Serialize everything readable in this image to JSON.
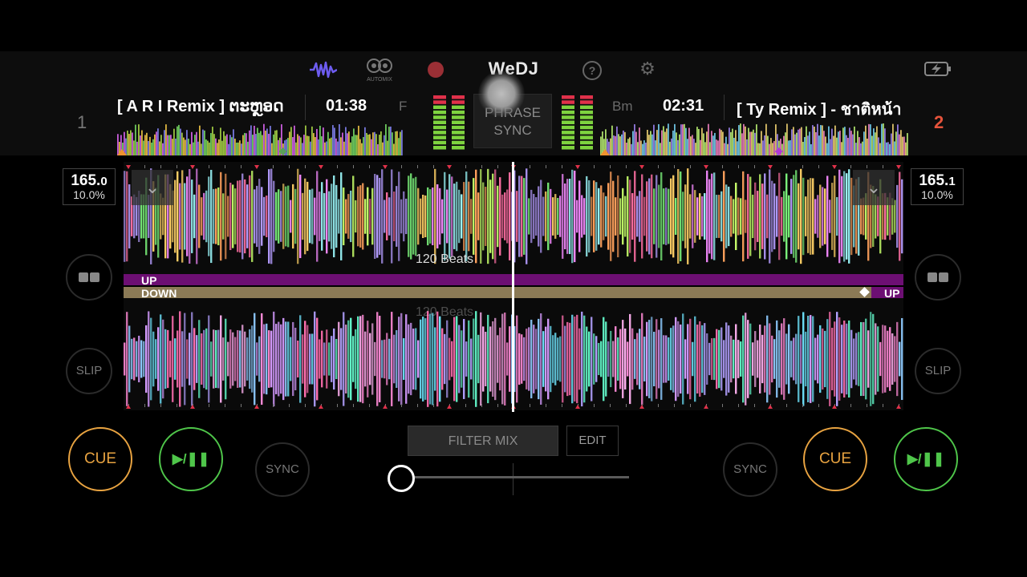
{
  "app": {
    "logo": "WeDJ"
  },
  "header": {
    "automix_label": "AUTOMIX",
    "help_glyph": "?",
    "icons": [
      "waveform-icon",
      "automix-icon",
      "record-icon",
      "help-icon",
      "gear-icon",
      "battery-charging-icon"
    ]
  },
  "deck1": {
    "number": "1",
    "title": "[ A R I Remix ] ຕະຫຼອດ",
    "time": "01:38",
    "key": "F",
    "bpm": "165.0",
    "bpm_big": "165.",
    "bpm_small": "0",
    "pitch": "10.0%",
    "beats_label": "120 Beats",
    "cue_label": "CUE",
    "play_label": "▶/❚❚",
    "sync_label": "SYNC",
    "slip_label": "SLIP",
    "color": "#777777"
  },
  "deck2": {
    "number": "2",
    "title": "[ Ty Remix ] - ชาติหน้า",
    "time": "02:31",
    "key": "Bm",
    "bpm": "165.1",
    "bpm_big": "165.",
    "bpm_small": "1",
    "pitch": "10.0%",
    "beats_label": "120 Beats",
    "cue_label": "CUE",
    "play_label": "▶/❚❚",
    "sync_label": "SYNC",
    "slip_label": "SLIP",
    "color": "#e5533b"
  },
  "center": {
    "phrase_sync_line1": "PHRASE",
    "phrase_sync_line2": "SYNC",
    "filter_mix_label": "FILTER MIX",
    "edit_label": "EDIT",
    "crossfader_position": 0.0
  },
  "phrase_bars": {
    "up_label": "UP",
    "down_label": "DOWN",
    "up_right_label": "UP"
  },
  "colors": {
    "cue": "#e8a341",
    "play": "#4fc64a",
    "phrase_up": "#6d0f73",
    "phrase_down": "#8b7a56"
  }
}
